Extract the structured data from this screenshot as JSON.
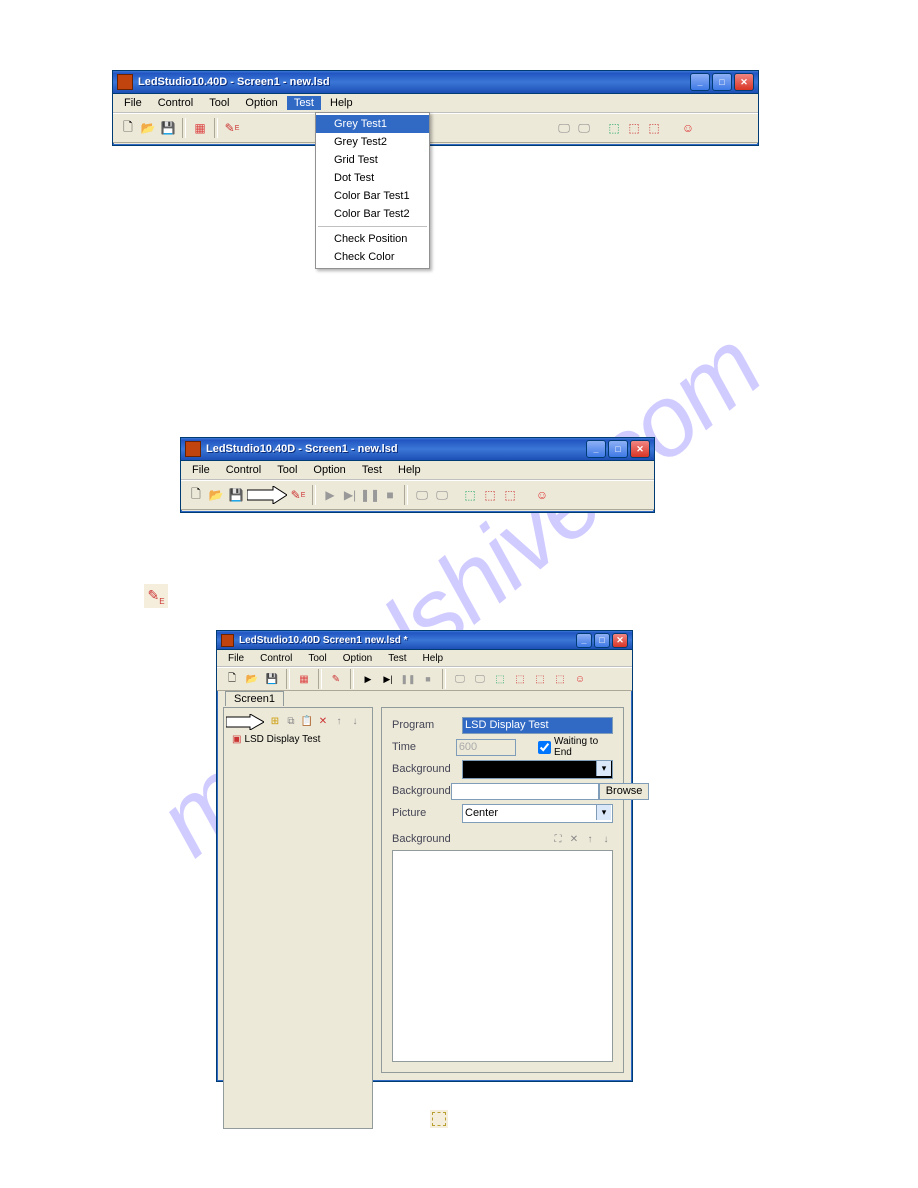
{
  "watermark": "manualshive.com",
  "window1": {
    "title": "LedStudio10.40D - Screen1 - new.lsd",
    "menu": [
      "File",
      "Control",
      "Tool",
      "Option",
      "Test",
      "Help"
    ],
    "dropdown": {
      "items": [
        "Grey Test1",
        "Grey Test2",
        "Grid Test",
        "Dot Test",
        "Color Bar Test1",
        "Color Bar Test2",
        "Check Position",
        "Check Color"
      ],
      "highlight": "Grey Test1"
    }
  },
  "window2": {
    "title": "LedStudio10.40D - Screen1 - new.lsd",
    "menu": [
      "File",
      "Control",
      "Tool",
      "Option",
      "Test",
      "Help"
    ]
  },
  "window3": {
    "title": "LedStudio10.40D  Screen1   new.lsd *",
    "menu": [
      "File",
      "Control",
      "Tool",
      "Option",
      "Test",
      "Help"
    ],
    "tab": "Screen1",
    "tree_item": "LSD Display Test",
    "program_label": "Program",
    "program_value": "LSD Display Test",
    "time_label": "Time",
    "time_value": "600",
    "waiting_label": "Waiting to End",
    "background1_label": "Background",
    "background2_label": "Background",
    "browse_button": "Browse",
    "picture_label": "Picture",
    "picture_value": "Center",
    "background3_label": "Background"
  }
}
